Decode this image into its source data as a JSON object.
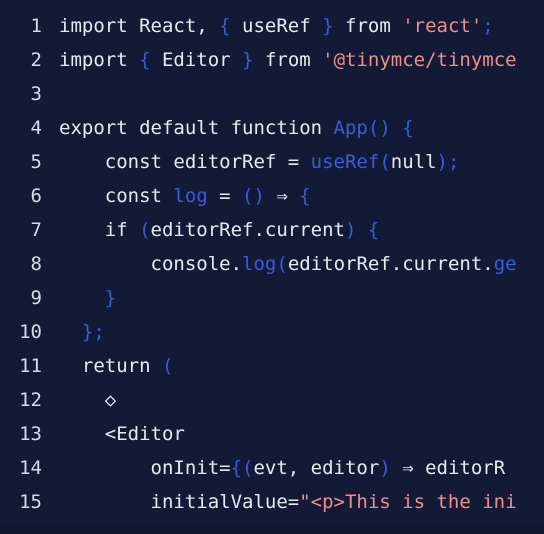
{
  "editor": {
    "theme_name": "dark-navy",
    "colors": {
      "background": "#131a36",
      "gutter_text": "#d8dce8",
      "plain_text": "#e8eaf2",
      "punctuation": "#3b5bdb",
      "function": "#3b5bdb",
      "string": "#f08d8d",
      "bottom_edge": "#10162e"
    },
    "first_visible_line": 1,
    "last_visible_line": 15,
    "lines": [
      {
        "number": "1",
        "tokens": [
          {
            "text": "import React, ",
            "type": "plain"
          },
          {
            "text": "{",
            "type": "punct"
          },
          {
            "text": " useRef ",
            "type": "plain"
          },
          {
            "text": "}",
            "type": "punct"
          },
          {
            "text": " from ",
            "type": "plain"
          },
          {
            "text": "'react'",
            "type": "string"
          },
          {
            "text": ";",
            "type": "punct"
          }
        ]
      },
      {
        "number": "2",
        "tokens": [
          {
            "text": "import ",
            "type": "plain"
          },
          {
            "text": "{",
            "type": "punct"
          },
          {
            "text": " Editor ",
            "type": "plain"
          },
          {
            "text": "}",
            "type": "punct"
          },
          {
            "text": " from ",
            "type": "plain"
          },
          {
            "text": "'@tinymce/tinymce",
            "type": "string"
          }
        ]
      },
      {
        "number": "3",
        "tokens": []
      },
      {
        "number": "4",
        "tokens": [
          {
            "text": "export default function ",
            "type": "plain"
          },
          {
            "text": "App",
            "type": "func"
          },
          {
            "text": "()",
            "type": "punct"
          },
          {
            "text": " ",
            "type": "plain"
          },
          {
            "text": "{",
            "type": "punct"
          }
        ]
      },
      {
        "number": "5",
        "tokens": [
          {
            "text": "    const editorRef = ",
            "type": "plain"
          },
          {
            "text": "useRef",
            "type": "func"
          },
          {
            "text": "(",
            "type": "punct"
          },
          {
            "text": "null",
            "type": "plain"
          },
          {
            "text": ")",
            "type": "punct"
          },
          {
            "text": ";",
            "type": "punct"
          }
        ]
      },
      {
        "number": "6",
        "tokens": [
          {
            "text": "    const ",
            "type": "plain"
          },
          {
            "text": "log",
            "type": "func"
          },
          {
            "text": " = ",
            "type": "plain"
          },
          {
            "text": "()",
            "type": "punct"
          },
          {
            "text": " ⇒ ",
            "type": "plain"
          },
          {
            "text": "{",
            "type": "punct"
          }
        ]
      },
      {
        "number": "7",
        "tokens": [
          {
            "text": "    if ",
            "type": "plain"
          },
          {
            "text": "(",
            "type": "punct"
          },
          {
            "text": "editorRef.current",
            "type": "plain"
          },
          {
            "text": ")",
            "type": "punct"
          },
          {
            "text": " ",
            "type": "plain"
          },
          {
            "text": "{",
            "type": "punct"
          }
        ]
      },
      {
        "number": "8",
        "tokens": [
          {
            "text": "        console.",
            "type": "plain"
          },
          {
            "text": "log",
            "type": "func"
          },
          {
            "text": "(",
            "type": "punct"
          },
          {
            "text": "editorRef.current.",
            "type": "plain"
          },
          {
            "text": "ge",
            "type": "func"
          }
        ]
      },
      {
        "number": "9",
        "tokens": [
          {
            "text": "    ",
            "type": "plain"
          },
          {
            "text": "}",
            "type": "punct"
          }
        ]
      },
      {
        "number": "10",
        "tokens": [
          {
            "text": "  ",
            "type": "plain"
          },
          {
            "text": "}",
            "type": "punct"
          },
          {
            "text": ";",
            "type": "punct"
          }
        ]
      },
      {
        "number": "11",
        "tokens": [
          {
            "text": "  return ",
            "type": "plain"
          },
          {
            "text": "(",
            "type": "punct"
          }
        ]
      },
      {
        "number": "12",
        "tokens": [
          {
            "text": "    ◇",
            "type": "plain"
          }
        ]
      },
      {
        "number": "13",
        "tokens": [
          {
            "text": "    <Editor",
            "type": "plain"
          }
        ]
      },
      {
        "number": "14",
        "tokens": [
          {
            "text": "        onInit=",
            "type": "plain"
          },
          {
            "text": "{(",
            "type": "punct"
          },
          {
            "text": "evt, editor",
            "type": "plain"
          },
          {
            "text": ")",
            "type": "punct"
          },
          {
            "text": " ⇒ editorR",
            "type": "plain"
          }
        ]
      },
      {
        "number": "15",
        "tokens": [
          {
            "text": "        initialValue=",
            "type": "plain"
          },
          {
            "text": "\"<p>This is the ini",
            "type": "string"
          }
        ]
      }
    ]
  }
}
